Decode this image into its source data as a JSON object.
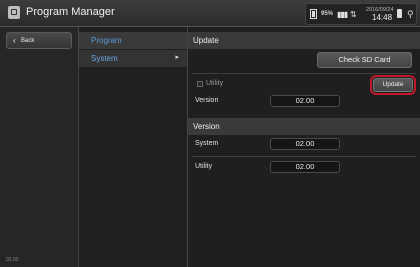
{
  "header": {
    "title": "Program Manager",
    "status": {
      "battery_percent": "95%",
      "date": "2016/09/24",
      "time": "14:48",
      "battery_icon": "battery-icon",
      "signal_icon": "signal-icon",
      "network_icon": "network-icon",
      "sd_icon": "sd-card-icon",
      "usb_icon": "usb-icon"
    }
  },
  "left": {
    "back_label": "Back",
    "version_text": "02.00"
  },
  "menu": {
    "items": [
      {
        "label": "Program"
      },
      {
        "label": "System"
      }
    ]
  },
  "update_section": {
    "title": "Update",
    "check_button": "Check SD Card",
    "utility_label": "Utility",
    "update_button": "Update",
    "version_label": "Version",
    "version_value": "02.00"
  },
  "version_section": {
    "title": "Version",
    "rows": [
      {
        "label": "System",
        "value": "02.00"
      },
      {
        "label": "Utility",
        "value": "02.00"
      }
    ]
  },
  "colors": {
    "accent_blue": "#5b9bd5",
    "highlight_red": "#c2182b"
  }
}
